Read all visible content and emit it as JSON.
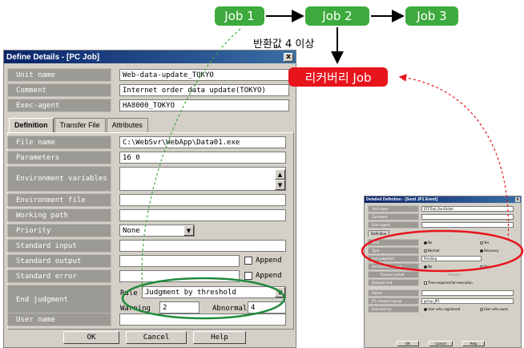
{
  "flow": {
    "jobs": [
      "Job 1",
      "Job 2",
      "Job 3"
    ],
    "condition": "반환값 4 이상",
    "recovery": "리커버리 Job"
  },
  "dialog": {
    "title": "Define Details - [PC Job]",
    "close": "x",
    "header_fields": [
      {
        "label": "Unit name",
        "value": "Web-data-update_TOKYO"
      },
      {
        "label": "Comment",
        "value": "Internet order data update(TOKYO)"
      },
      {
        "label": "Exec-agent",
        "value": "HA8000_TOKYO"
      }
    ],
    "tabs": [
      "Definition",
      "Transfer File",
      "Attributes"
    ],
    "fields": {
      "file_name": {
        "label": "File name",
        "value": "C:\\WebSvr\\WebApp\\Data01.exe"
      },
      "parameters": {
        "label": "Parameters",
        "value": "16 0"
      },
      "env_vars": {
        "label": "Environment variables",
        "value": ""
      },
      "env_file": {
        "label": "Environment file",
        "value": ""
      },
      "working_path": {
        "label": "Working path",
        "value": ""
      },
      "priority": {
        "label": "Priority",
        "value": "None"
      },
      "std_input": {
        "label": "Standard input",
        "value": ""
      },
      "std_output": {
        "label": "Standard output",
        "value": "",
        "append": "Append"
      },
      "std_error": {
        "label": "Standard error",
        "value": "",
        "append": "Append"
      },
      "end_judgment": {
        "label": "End judgment",
        "rule_label": "Rule",
        "rule_value": "Judgment by threshold",
        "warning_label": "Warning",
        "warning_value": "2",
        "abnormal_label": "Abnormal",
        "abnormal_value": "4"
      },
      "user_name": {
        "label": "User name",
        "value": ""
      }
    },
    "buttons": {
      "ok": "OK",
      "cancel": "Cancel",
      "help": "Help"
    }
  },
  "mini_dialog": {
    "title": "Detailed Definition - [Send JP1 Event]",
    "close": "x",
    "rows": [
      {
        "label": "Unit name",
        "value": "ETCTool_RunFailed"
      },
      {
        "label": "Comment",
        "value": ""
      },
      {
        "label": "Exec-agent",
        "value": ""
      }
    ],
    "tab": "Definition",
    "options": {
      "hold": {
        "label": "Hold",
        "a": "No",
        "b": "Yes"
      },
      "type": {
        "label": "Type",
        "a": "Normal",
        "b": "Recovery"
      },
      "end_judge": {
        "label": "End judgment",
        "value": "Pending"
      },
      "set_timeout": {
        "label": "Set timeout period",
        "a": "No",
        "b": "Yes"
      },
      "timeout": {
        "label": "Timeout period",
        "value": "minutes"
      },
      "delayed_end": {
        "label": "Delayed end",
        "value": "Time-required-for-execution"
      },
      "owner": {
        "label": "Owner",
        "value": ""
      },
      "resource": {
        "label": "JP1 resource group",
        "value": "group_JP1"
      },
      "executed_by": {
        "label": "Executed by",
        "a": "User who registered",
        "b": "User who owns"
      }
    },
    "buttons": {
      "ok": "OK",
      "cancel": "Cancel",
      "help": "Help"
    }
  },
  "colors": {
    "job": "#3daa3d",
    "recovery": "#e8141c",
    "ellipse_green": "#1f8a3a",
    "ellipse_red": "#e8141c"
  }
}
